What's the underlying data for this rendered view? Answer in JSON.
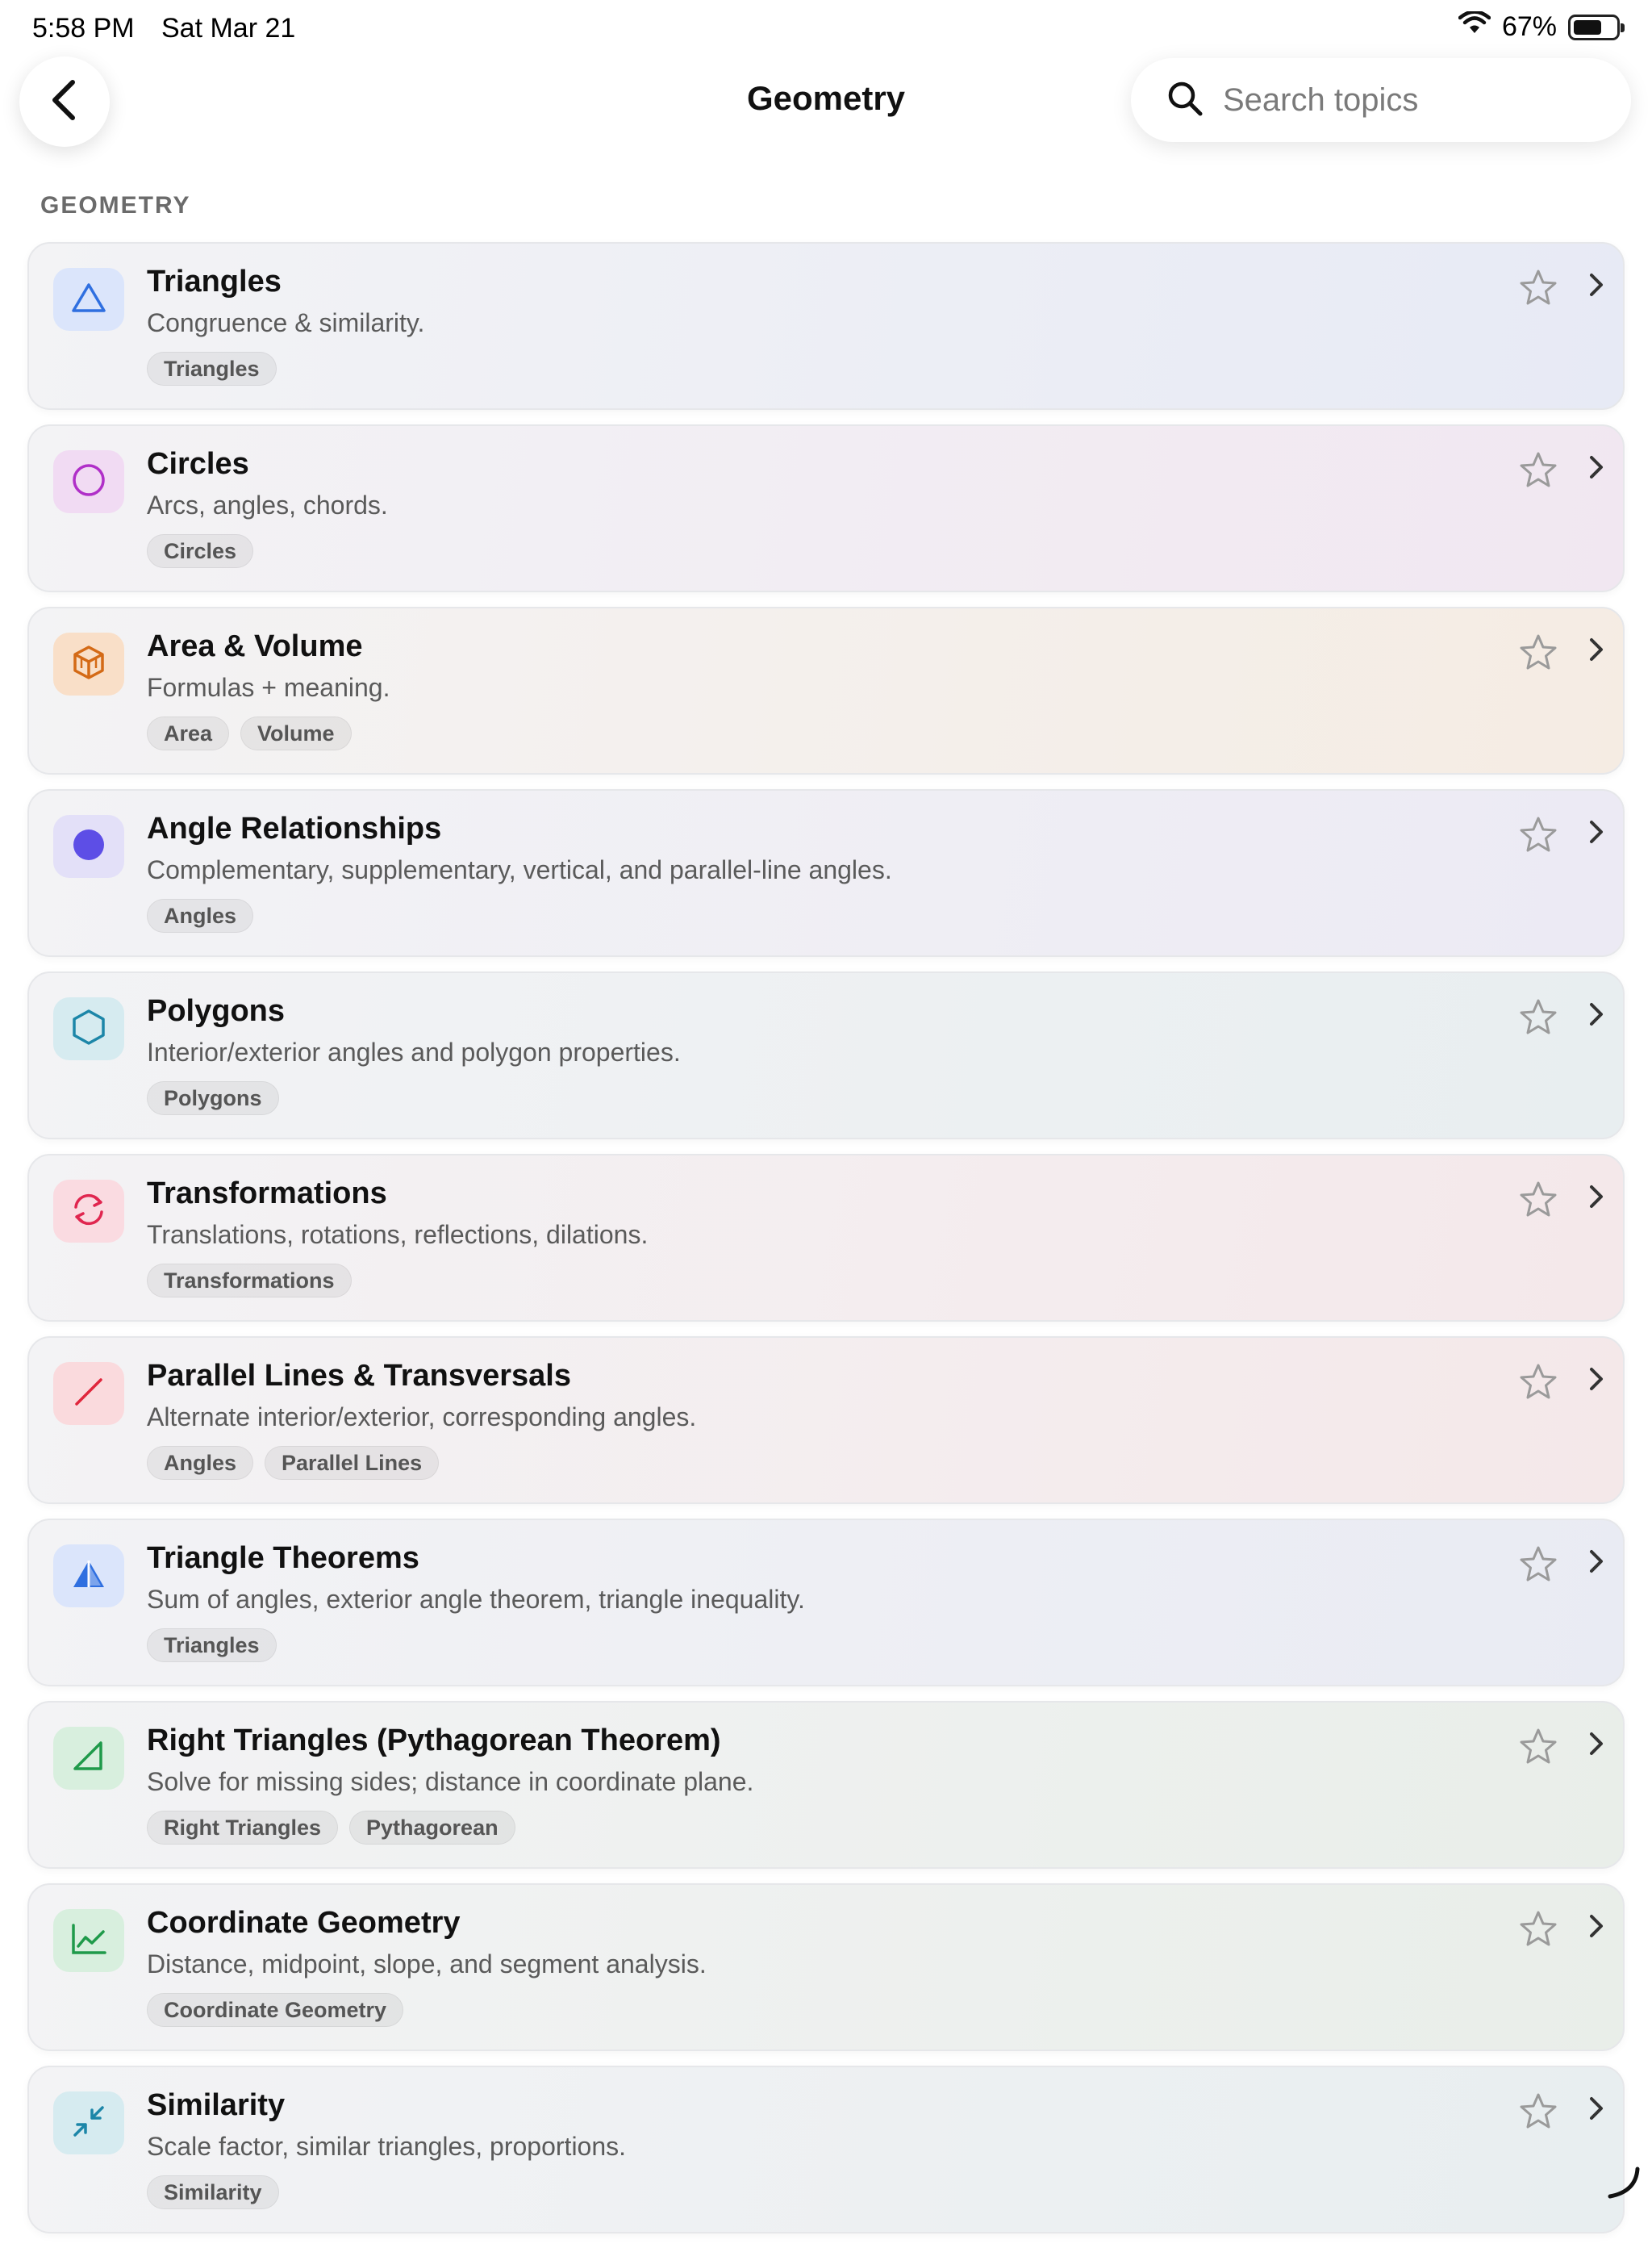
{
  "status": {
    "time": "5:58 PM",
    "date": "Sat Mar 21",
    "battery": "67%",
    "battery_level": 0.67
  },
  "header": {
    "title": "Geometry",
    "back_icon": "chevron-left-icon"
  },
  "search": {
    "placeholder": "Search topics",
    "value": "",
    "icon": "search-icon"
  },
  "section": {
    "label": "GEOMETRY"
  },
  "topics": [
    {
      "title": "Triangles",
      "description": "Congruence & similarity.",
      "tags": [
        "Triangles"
      ],
      "icon": "triangle-icon",
      "accent": "#2f6fe0",
      "tint": "#e7eaf5",
      "icon_bg": "#dbe5fb"
    },
    {
      "title": "Circles",
      "description": "Arcs, angles, chords.",
      "tags": [
        "Circles"
      ],
      "icon": "circle-icon",
      "accent": "#b02fc8",
      "tint": "#f1e7f1",
      "icon_bg": "#f1dbf3"
    },
    {
      "title": "Area & Volume",
      "description": "Formulas + meaning.",
      "tags": [
        "Area",
        "Volume"
      ],
      "icon": "cube-icon",
      "accent": "#d46a16",
      "tint": "#f5ece3",
      "icon_bg": "#f9dfc8"
    },
    {
      "title": "Angle Relationships",
      "description": "Complementary, supplementary, vertical, and parallel-line angles.",
      "tags": [
        "Angles"
      ],
      "icon": "filled-circle-icon",
      "accent": "#5d4ee6",
      "tint": "#eceaf4",
      "icon_bg": "#e3e0f8"
    },
    {
      "title": "Polygons",
      "description": "Interior/exterior angles and polygon properties.",
      "tags": [
        "Polygons"
      ],
      "icon": "hexagon-icon",
      "accent": "#1c86a8",
      "tint": "#e8eef0",
      "icon_bg": "#d6ebf0"
    },
    {
      "title": "Transformations",
      "description": "Translations, rotations, reflections, dilations.",
      "tags": [
        "Transformations"
      ],
      "icon": "rotate-arrows-icon",
      "accent": "#e0264f",
      "tint": "#f4e8ea",
      "icon_bg": "#fadbe1"
    },
    {
      "title": "Parallel Lines & Transversals",
      "description": "Alternate interior/exterior, corresponding angles.",
      "tags": [
        "Angles",
        "Parallel Lines"
      ],
      "icon": "slash-line-icon",
      "accent": "#e0263c",
      "tint": "#f4e8e9",
      "icon_bg": "#fadadd"
    },
    {
      "title": "Triangle Theorems",
      "description": "Sum of angles, exterior angle theorem, triangle inequality.",
      "tags": [
        "Triangles"
      ],
      "icon": "split-triangle-icon",
      "accent": "#2f6fe0",
      "tint": "#e9ebf3",
      "icon_bg": "#dbe5fb"
    },
    {
      "title": "Right Triangles (Pythagorean Theorem)",
      "description": "Solve for missing sides; distance in coordinate plane.",
      "tags": [
        "Right Triangles",
        "Pythagorean"
      ],
      "icon": "right-triangle-icon",
      "accent": "#1f9a4a",
      "tint": "#e9eee9",
      "icon_bg": "#d8efde"
    },
    {
      "title": "Coordinate Geometry",
      "description": "Distance, midpoint, slope, and segment analysis.",
      "tags": [
        "Coordinate Geometry"
      ],
      "icon": "line-chart-icon",
      "accent": "#1f9a4a",
      "tint": "#e9eee9",
      "icon_bg": "#d8efde"
    },
    {
      "title": "Similarity",
      "description": "Scale factor, similar triangles, proportions.",
      "tags": [
        "Similarity"
      ],
      "icon": "arrows-in-icon",
      "accent": "#1c86a8",
      "tint": "#e8eef0",
      "icon_bg": "#d6ebf0"
    }
  ]
}
